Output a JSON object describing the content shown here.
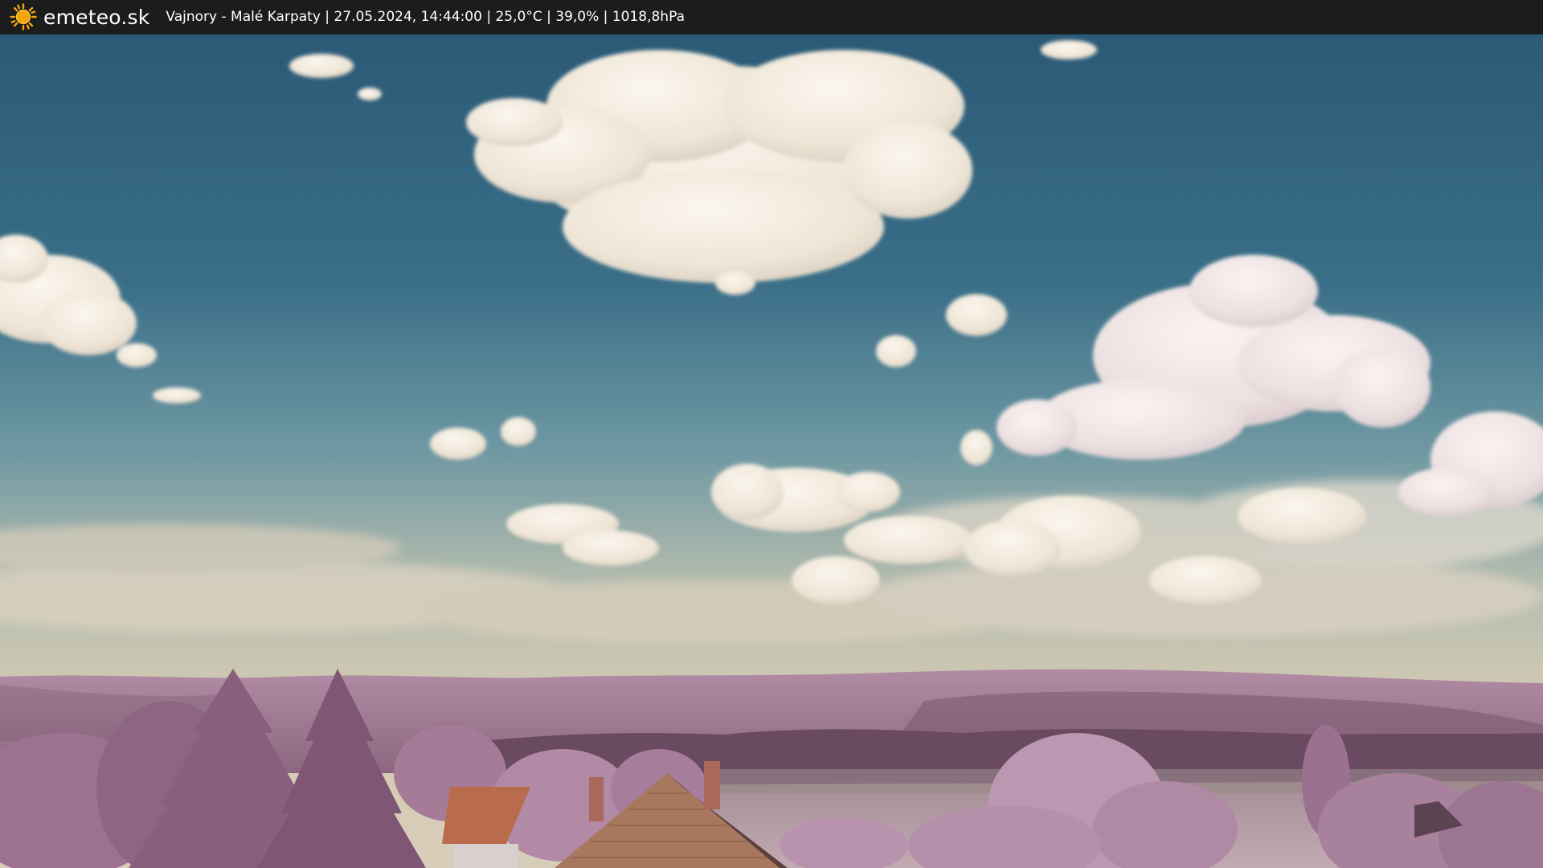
{
  "header": {
    "brand": "emeteo.sk",
    "brand_icon": "sun-icon",
    "location": "Vajnory - Malé Karpaty",
    "datetime": "27.05.2024, 14:44:00",
    "temperature": "25,0°C",
    "humidity": "39,0%",
    "pressure": "1018,8hPa",
    "separator": " | "
  },
  "colors": {
    "bar_background": "#1c1c1c",
    "sun_icon": "#f2a60c",
    "sky_top": "#2f5d78",
    "sky_horizon": "#cfc7b3",
    "hills": "#a27a95",
    "trees": "#b0809e",
    "roof": "#b5674a"
  }
}
